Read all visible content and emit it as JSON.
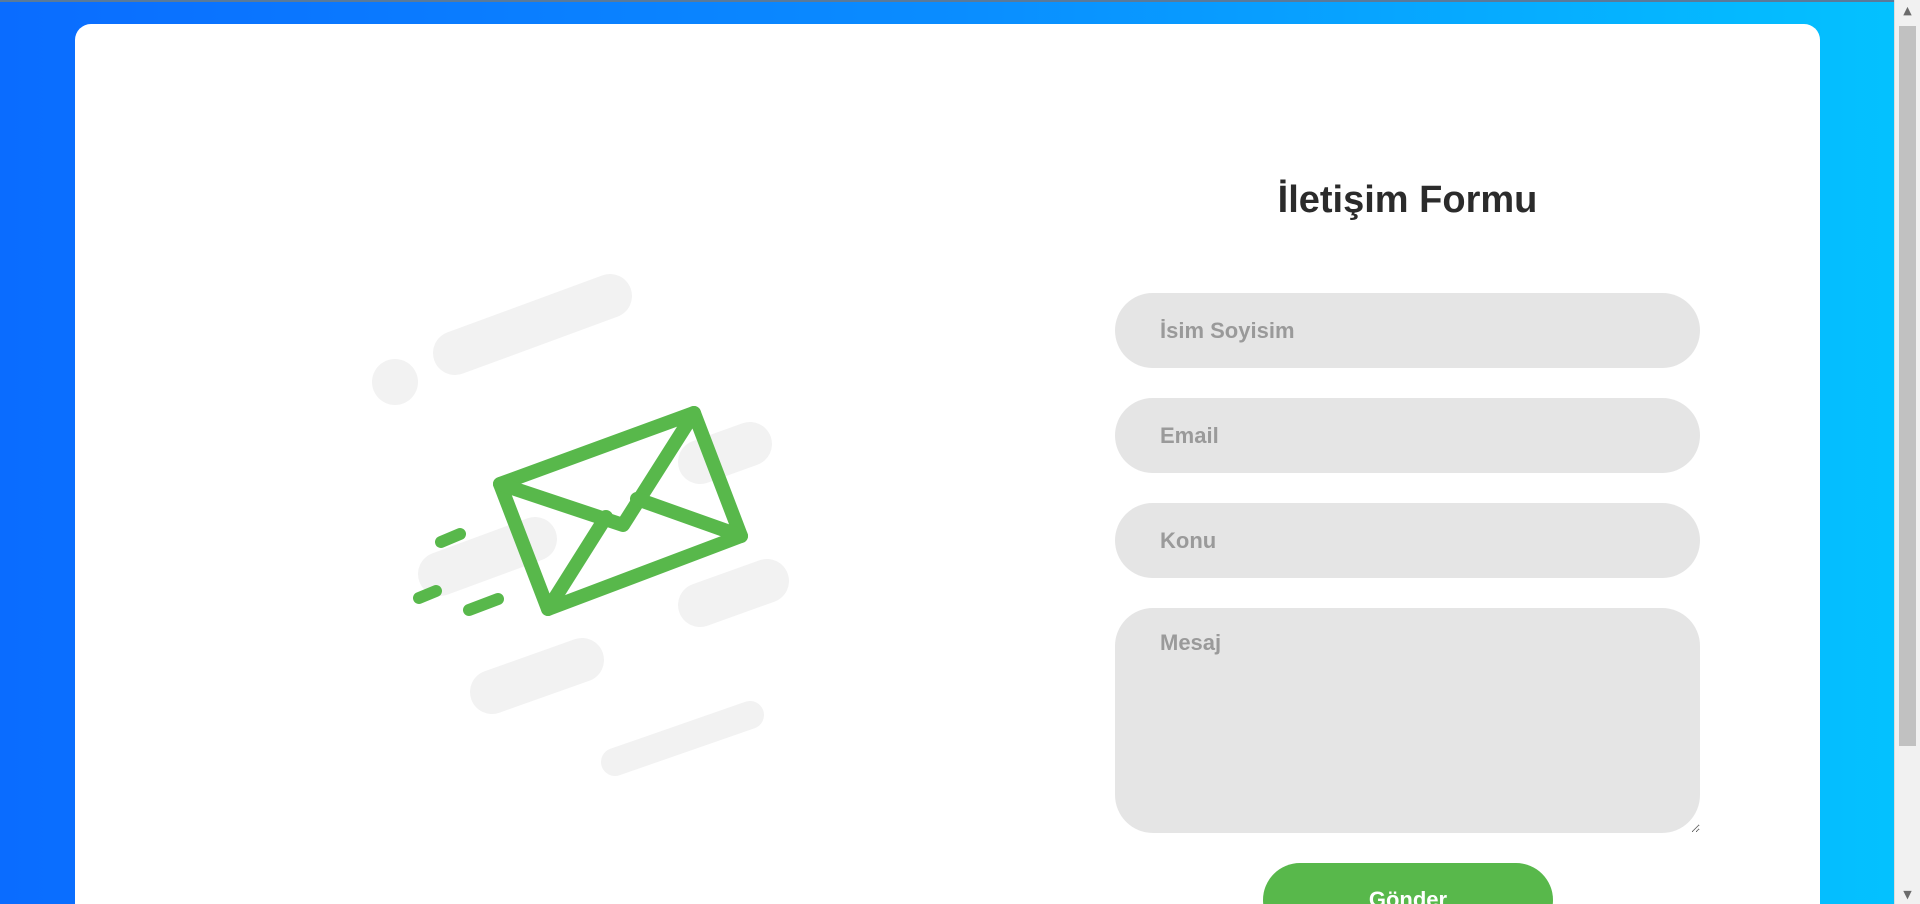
{
  "form": {
    "title": "İletişim Formu",
    "name_placeholder": "İsim Soyisim",
    "email_placeholder": "Email",
    "subject_placeholder": "Konu",
    "message_placeholder": "Mesaj",
    "submit_label": "Gönder"
  },
  "illustration": {
    "icon": "envelope-icon",
    "accent_color": "#58b84b"
  },
  "colors": {
    "background_gradient_start": "#0a6cff",
    "background_gradient_end": "#03c3ff",
    "field_background": "#e5e5e5",
    "button_background": "#58b84b"
  },
  "scrollbar": {
    "up_glyph": "▲",
    "down_glyph": "▼"
  }
}
